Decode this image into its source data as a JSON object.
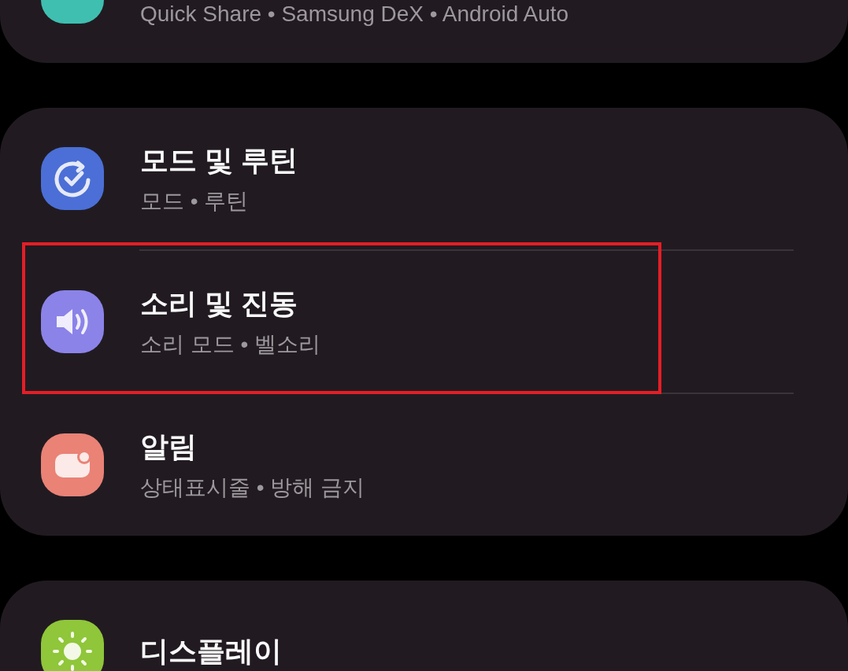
{
  "cards": [
    {
      "cut_top": true,
      "items": [
        {
          "subtitle": "Quick Share • Samsung DeX • Android Auto",
          "color": "#3fbfb0",
          "highlighted": false
        }
      ]
    },
    {
      "cut_top": false,
      "items": [
        {
          "title": "모드 및 루틴",
          "subtitle": "모드 • 루틴",
          "color": "#4b6fd6",
          "highlighted": false
        },
        {
          "title": "소리 및 진동",
          "subtitle": "소리 모드 • 벨소리",
          "color": "#8b83e8",
          "highlighted": true
        },
        {
          "title": "알림",
          "subtitle": "상태표시줄 • 방해 금지",
          "color": "#ea8276",
          "highlighted": false
        }
      ]
    },
    {
      "cut_top": false,
      "items": [
        {
          "title": "디스플레이",
          "color": "#8fc63a",
          "highlighted": false
        }
      ]
    }
  ]
}
